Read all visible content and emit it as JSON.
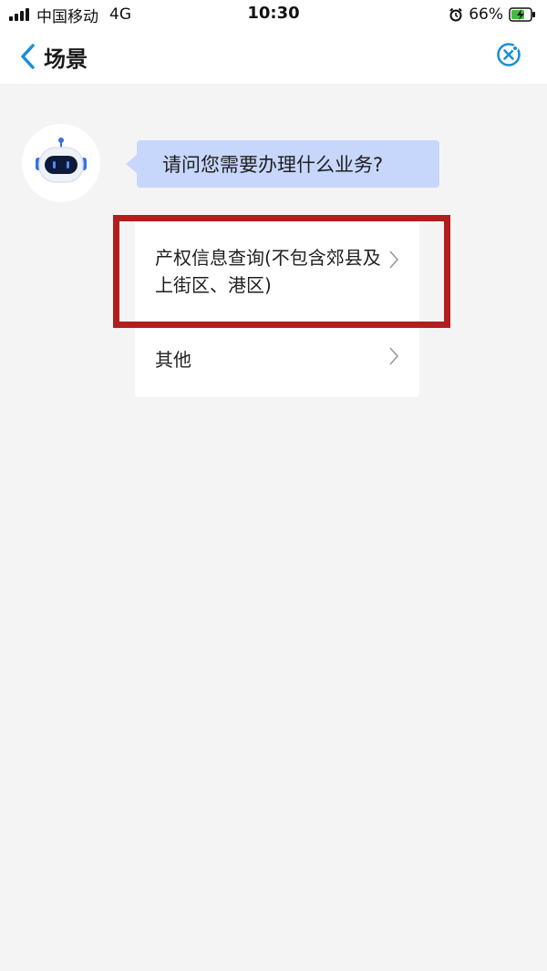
{
  "status_bar": {
    "carrier": "中国移动",
    "network": "4G",
    "time": "10:30",
    "battery": "66%",
    "icons": {
      "signal": "signal-icon",
      "alarm": "alarm-icon",
      "battery": "battery-charging-icon"
    }
  },
  "nav": {
    "title": "场景",
    "icons": {
      "back": "chevron-left-icon",
      "settings": "settings-icon"
    }
  },
  "chat": {
    "question": "请问您需要办理什么业务?",
    "avatar_icon": "robot-icon",
    "options": [
      {
        "label": "产权信息查询(不包含郊县及上街区、港区)",
        "highlighted": true
      },
      {
        "label": "其他",
        "highlighted": false
      }
    ]
  },
  "colors": {
    "accent": "#1a8fd6",
    "bubble": "#c7d6fb",
    "highlight": "#b21d1d",
    "background": "#f4f4f5"
  }
}
